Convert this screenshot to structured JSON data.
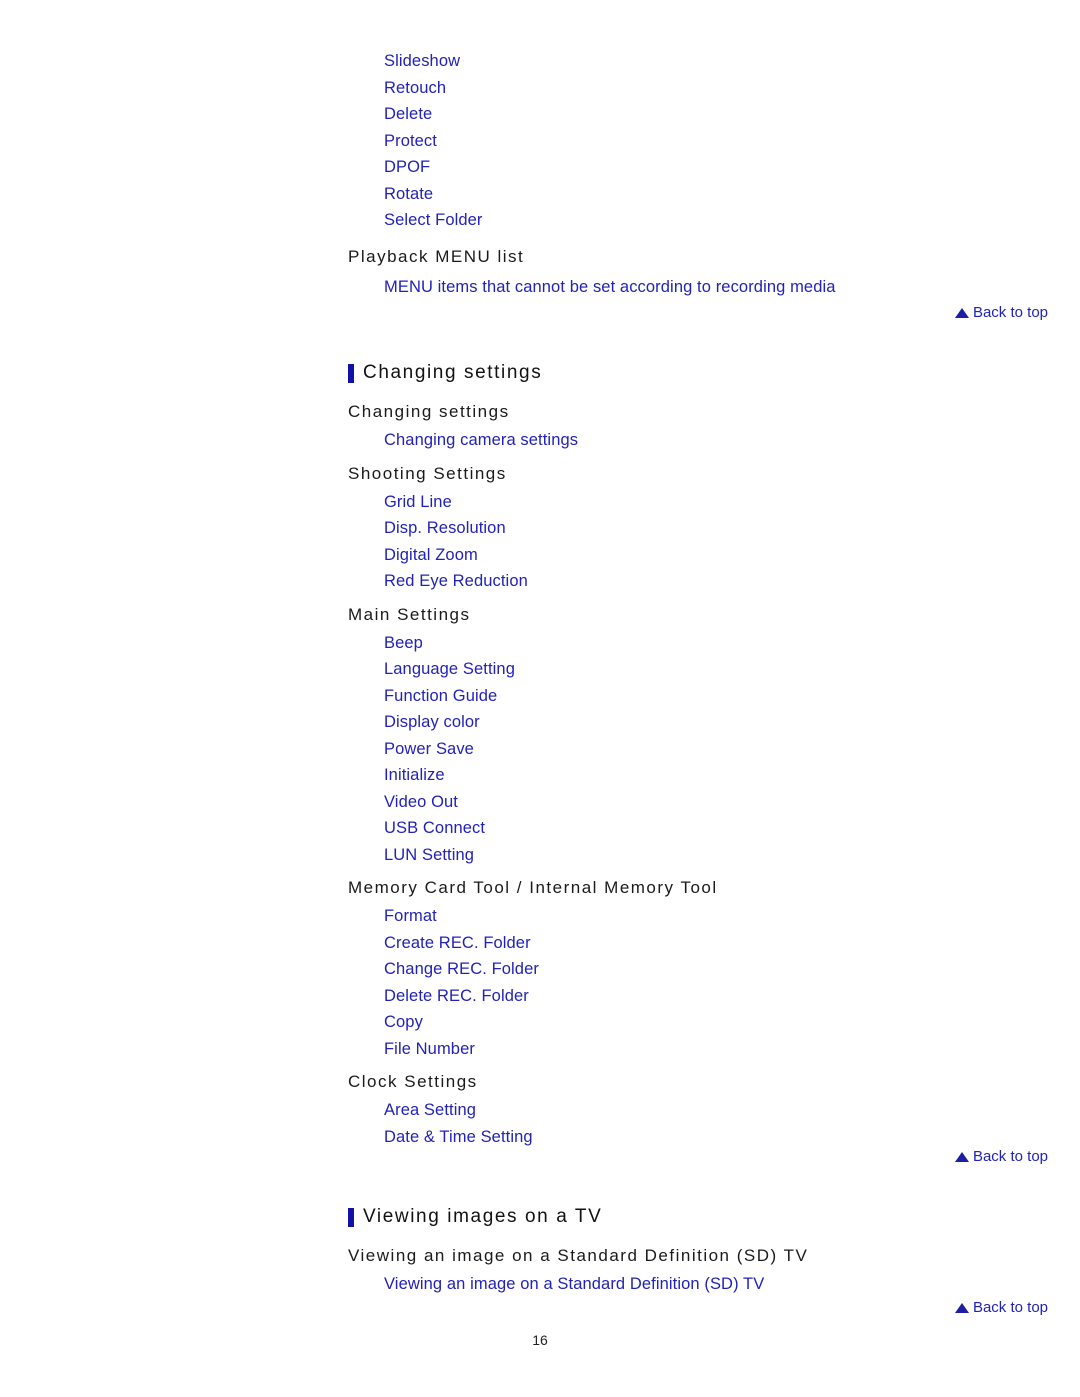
{
  "document": {
    "page_number": "16",
    "link_color": "#2222bb",
    "accent_bar_color": "#1111a8",
    "heading_color": "#1a1a1a",
    "background_color": "#ffffff"
  },
  "back_to_top": {
    "label": "Back to top",
    "icon": "triangle-up-icon"
  },
  "blocks": {
    "playback_menu_links": [
      "Slideshow",
      "Retouch",
      "Delete",
      "Protect",
      "DPOF",
      "Rotate",
      "Select Folder"
    ],
    "playback_menu_heading": "Playback MENU list",
    "playback_menu_list_link": "MENU items that cannot be set according to recording media"
  },
  "sections": [
    {
      "title": "Changing settings",
      "groups": [
        {
          "heading": "Changing settings",
          "links": [
            "Changing camera settings"
          ]
        },
        {
          "heading": "Shooting Settings",
          "links": [
            "Grid Line",
            "Disp. Resolution",
            "Digital Zoom",
            "Red Eye Reduction"
          ]
        },
        {
          "heading": "Main Settings",
          "links": [
            "Beep",
            "Language Setting",
            "Function Guide",
            "Display color",
            "Power Save",
            "Initialize",
            "Video Out",
            "USB Connect",
            "LUN Setting"
          ]
        },
        {
          "heading": "Memory Card Tool / Internal Memory Tool",
          "links": [
            "Format",
            "Create REC. Folder",
            "Change REC. Folder",
            "Delete REC. Folder",
            "Copy",
            "File Number"
          ]
        },
        {
          "heading": "Clock Settings",
          "links": [
            "Area Setting",
            "Date & Time Setting"
          ]
        }
      ]
    },
    {
      "title": "Viewing images on a TV",
      "groups": [
        {
          "heading": "Viewing an image on a Standard Definition (SD) TV",
          "links": [
            "Viewing an image on a Standard Definition (SD) TV"
          ]
        }
      ]
    }
  ]
}
